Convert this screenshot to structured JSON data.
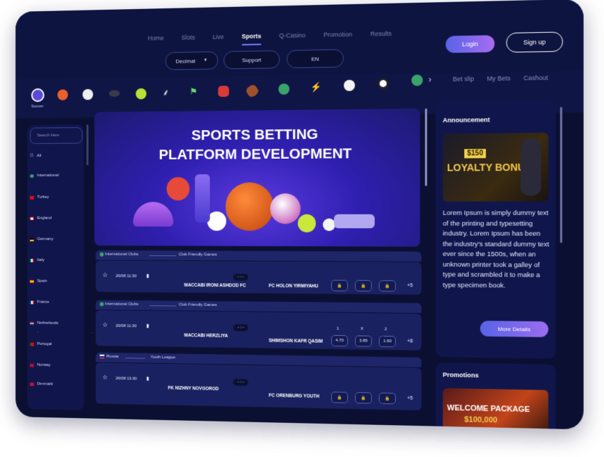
{
  "nav": {
    "items": [
      "Home",
      "Slots",
      "Live",
      "Sports",
      "Q-Casino",
      "Promotion",
      "Results"
    ],
    "active": "Sports"
  },
  "controls": {
    "odds_format": "Decimal",
    "support": "Support",
    "language": "EN"
  },
  "auth": {
    "login": "Login",
    "signup": "Sign up"
  },
  "sports_bar": {
    "selected_label": "Soccer",
    "bet_links": [
      "Bet slip",
      "My Bets",
      "Cashout"
    ]
  },
  "sidebar": {
    "search_placeholder": "Search Here",
    "items": [
      "All",
      "International",
      "Turkey",
      "England",
      "Germany",
      "Italy",
      "Spain",
      "France",
      "Netherlands",
      "Portugal",
      "Norway",
      "Denmark"
    ]
  },
  "banner": {
    "line1": "SPORTS BETTING",
    "line2": "PLATFORM DEVELOPMENT"
  },
  "matches": [
    {
      "group": "International Clubs",
      "league": "Club Friendly Games",
      "date": "26/08 11:30",
      "home": "MACCABI IRONI ASHDOD FC",
      "away": "FC HOLON YIRMIYAHU",
      "score": "- : -",
      "odds_labels": [
        "",
        "",
        ""
      ],
      "odds": [
        "",
        "",
        ""
      ],
      "more": "+5"
    },
    {
      "group": "International Clubs",
      "league": "Club Friendly Games",
      "date": "26/08 11:30",
      "home": "MACCABI HERZLIYA",
      "away": "SHIMSHON KAFR QASIM",
      "score": "- : -",
      "odds_labels": [
        "1",
        "X",
        "2"
      ],
      "odds": [
        "4.70",
        "3.85",
        "1.60"
      ],
      "more": "+8"
    },
    {
      "group": "Russia",
      "league": "Youth League",
      "date": "26/08 13:30",
      "home": "FK NIZHNY NOVGOROD",
      "away": "FC ORENBURG YOUTH",
      "score": "- : -",
      "odds_labels": [
        "",
        "",
        ""
      ],
      "odds": [
        "",
        "",
        ""
      ],
      "more": "+5"
    }
  ],
  "announcement": {
    "title": "Announcement",
    "image_text_amount": "$150",
    "image_text": "LOYALTY BONUS",
    "body": "Lorem Ipsum is simply dummy text of the printing and typesetting industry. Lorem Ipsum has been the industry's standard dummy text ever since the 1500s, when an unknown printer took a galley of type and scrambled it to make a type specimen book.",
    "button": "More Details"
  },
  "promotions": {
    "title": "Promotions",
    "image_text": "WELCOME PACKAGE",
    "image_amount": "$100,000"
  },
  "colors": {
    "accent": "#6f7bff",
    "background": "#0b1033",
    "panel": "#10164b"
  }
}
